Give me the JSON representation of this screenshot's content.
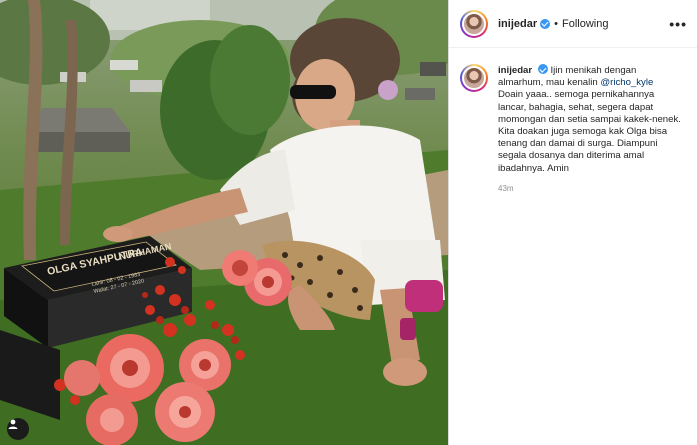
{
  "post": {
    "image_alt": "photo",
    "grave_name": "OLGA SYAHPUTRA",
    "grave_bin": "NURHAMAN",
    "grave_born": "Lahir: 08 - 02 - 1983",
    "grave_died": "Wafat: 27 - 07 - 2020"
  },
  "header": {
    "username": "inijedar",
    "separator": "•",
    "follow_status": "Following",
    "more_icon": "•••"
  },
  "caption": {
    "username": "inijedar",
    "line1_pre": "Ijin menikah dengan almarhum, mau kenalin ",
    "mention": "@richo_kyle",
    "para2": "Doain yaaa.. semoga pernikahannya lancar, bahagia, sehat, segera dapat momongan dan setia sampai kakek-nenek.",
    "para3": "Kita doakan juga semoga kak Olga bisa tenang dan damai di surga. Diampuni segala dosanya dan diterima amal ibadahnya. Amin",
    "timestamp": "43m"
  },
  "colors": {
    "verified": "#3897f0",
    "mention": "#00376b",
    "muted": "#8e8e8e"
  },
  "icons": {
    "verified": "verified-badge-icon",
    "more": "more-options-icon",
    "user_tag": "user-tag-icon"
  }
}
